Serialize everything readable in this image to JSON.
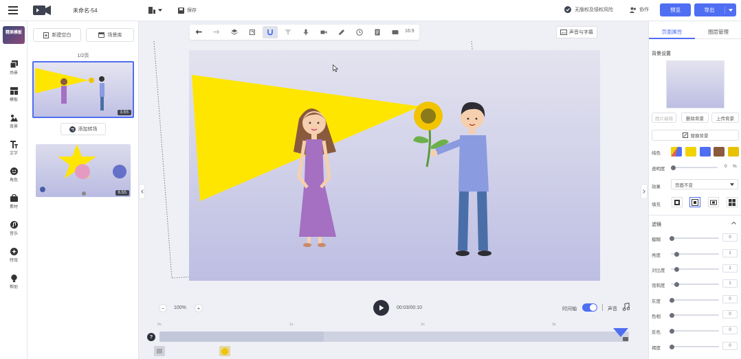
{
  "topbar": {
    "doc_title": "未命名-54",
    "save_label": "保存",
    "copyright_label": "无版权及侵权风险",
    "collab_label": "协作",
    "preview_label": "预览",
    "export_label": "导出"
  },
  "leftnav": {
    "items": [
      {
        "label": "场景"
      },
      {
        "label": "模板"
      },
      {
        "label": "背景"
      },
      {
        "label": "文字"
      },
      {
        "label": "角色"
      },
      {
        "label": "素材"
      },
      {
        "label": "音乐"
      },
      {
        "label": "特效"
      },
      {
        "label": "帮助"
      }
    ],
    "thumb_label": "精美模板"
  },
  "scenes": {
    "new_blank_label": "新建空白",
    "gallery_label": "场景库",
    "page_counter": "1/2页",
    "add_transition_label": "添加转场",
    "items": [
      {
        "duration": "3.5S"
      },
      {
        "duration": "6.5S"
      }
    ]
  },
  "toolbar": {
    "ratio_label": "16:9",
    "subtitle_label": "声音与字幕"
  },
  "playback": {
    "zoom": "100%",
    "zoom_minus": "−",
    "zoom_plus": "+",
    "time": "00:03/00:10",
    "timeline_label": "时间轴",
    "sound_label": "声音",
    "ticks": [
      "0s",
      "1s",
      "2s",
      "3s"
    ],
    "progress": 0.35,
    "help_label": "?"
  },
  "rpanel": {
    "tabs": [
      "页面属性",
      "图层管理"
    ],
    "bg_section": "背景设置",
    "bg_buttons": [
      "图片编辑",
      "删除背景",
      "上传背景"
    ],
    "replace_bg": "替换背景",
    "solid_label": "纯色",
    "opacity_label": "透明度",
    "opacity_value": "0",
    "opacity_unit": "%",
    "effect_label": "效果",
    "effect_value": "页面不变",
    "fill_label": "填充",
    "filter_section": "滤镜",
    "filters": [
      {
        "label": "模糊",
        "value": "0",
        "level": 0.0
      },
      {
        "label": "亮度",
        "value": "1",
        "level": 0.1
      },
      {
        "label": "对比度",
        "value": "1",
        "level": 0.1
      },
      {
        "label": "饱和度",
        "value": "1",
        "level": 0.1
      },
      {
        "label": "灰度",
        "value": "0",
        "level": 0.0
      },
      {
        "label": "色相",
        "value": "0",
        "level": 0.0
      },
      {
        "label": "反色",
        "value": "0",
        "level": 0.0
      },
      {
        "label": "褐度",
        "value": "0",
        "level": 0.0
      }
    ],
    "swatch_colors": [
      "#f2d300",
      "#4f6ef2",
      "#8a5a3c",
      "#e6c200"
    ]
  },
  "colors": {
    "accent": "#4f6ef2",
    "canvas_top": "#e2e1ee",
    "canvas_bottom": "#bcbde3",
    "beam": "#ffe600"
  }
}
